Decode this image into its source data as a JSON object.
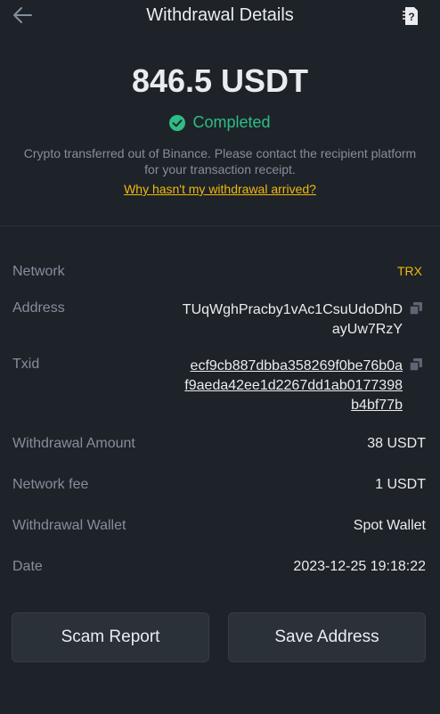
{
  "header": {
    "title": "Withdrawal Details"
  },
  "summary": {
    "amount": "846.5 USDT",
    "status": "Completed",
    "description": "Crypto transferred out of Binance. Please contact the recipient platform for your transaction receipt.",
    "help_link": "Why hasn't my withdrawal arrived?"
  },
  "details": {
    "network": {
      "label": "Network",
      "value": "TRX"
    },
    "address": {
      "label": "Address",
      "lines": [
        "TUqWghPracby1vAc1CsuUdoDhD",
        "ayUw7RzY"
      ]
    },
    "txid": {
      "label": "Txid",
      "lines": [
        "ecf9cb887dbba358269f0be76b0a",
        "f9aeda42ee1d2267dd1ab0177398",
        "b4bf77b"
      ]
    },
    "withdrawal_amount": {
      "label": "Withdrawal Amount",
      "value": "38 USDT"
    },
    "network_fee": {
      "label": "Network fee",
      "value": "1 USDT"
    },
    "withdrawal_wallet": {
      "label": "Withdrawal Wallet",
      "value": "Spot Wallet"
    },
    "date": {
      "label": "Date",
      "value": "2023-12-25 19:18:22"
    }
  },
  "actions": {
    "scam_report": "Scam Report",
    "save_address": "Save Address"
  },
  "icons": {
    "back": "arrow-left-icon",
    "help": "help-document-icon",
    "status": "check-circle-icon",
    "copy": "copy-icon"
  },
  "colors": {
    "background": "#1e2329",
    "text_primary": "#eaecef",
    "text_secondary": "#848e9c",
    "accent": "#f0b90b",
    "success": "#2ebd85"
  }
}
